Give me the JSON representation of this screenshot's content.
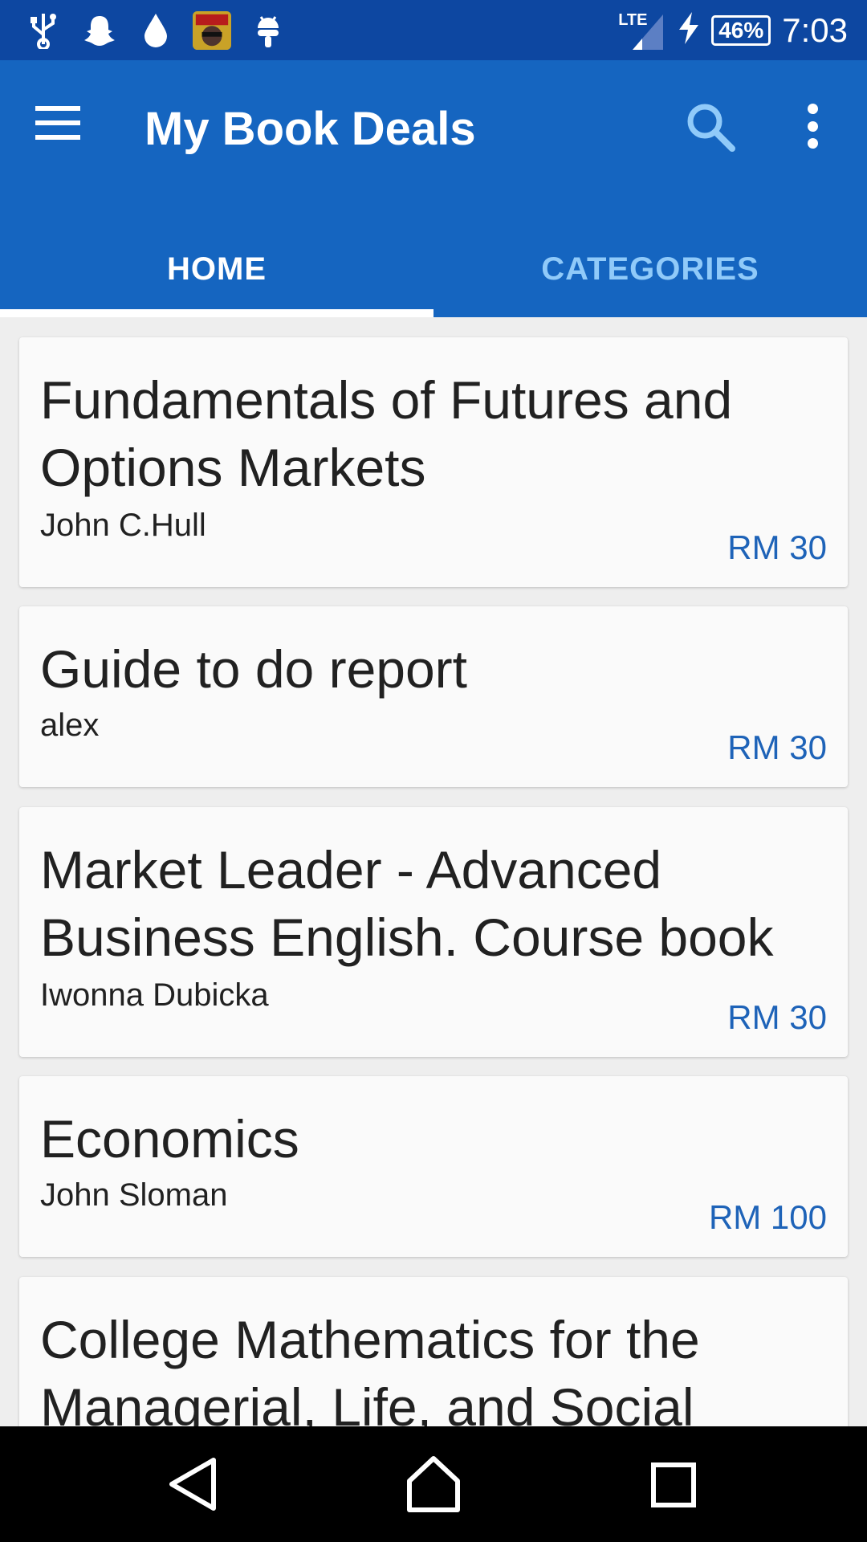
{
  "status_bar": {
    "icons": [
      "usb-icon",
      "snapchat-icon",
      "drop-icon",
      "game-app-icon",
      "android-icon"
    ],
    "network": "LTE",
    "battery": "46%",
    "time": "7:03"
  },
  "app_bar": {
    "title": "My Book Deals",
    "icons": [
      "menu-icon",
      "search-icon",
      "more-vert-icon"
    ]
  },
  "tabs": [
    {
      "label": "HOME",
      "active": true
    },
    {
      "label": "CATEGORIES",
      "active": false
    }
  ],
  "books": [
    {
      "title": "Fundamentals of Futures and Options Markets",
      "author": "John C.Hull",
      "price": "RM 30"
    },
    {
      "title": "Guide to do report",
      "author": "alex",
      "price": "RM 30"
    },
    {
      "title": "Market Leader - Advanced Business English. Course book",
      "author": "Iwonna Dubicka",
      "price": "RM 30"
    },
    {
      "title": "Economics",
      "author": "John Sloman",
      "price": "RM 100"
    },
    {
      "title": "College Mathematics for the Managerial, Life, and Social",
      "author": "",
      "price": ""
    }
  ],
  "nav_bar": [
    "back-icon",
    "home-icon",
    "recents-icon"
  ]
}
